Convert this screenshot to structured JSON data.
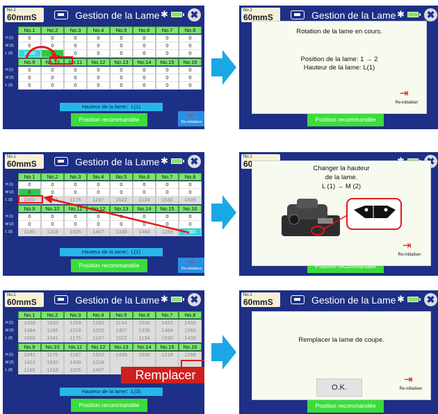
{
  "header": {
    "mode_number": "No.1",
    "mode_value": "60mmS",
    "title": "Gestion de la Lame",
    "bluetooth_glyph": "✱",
    "close_glyph": "✖"
  },
  "columns_top": [
    "No.1",
    "No.2",
    "No.3",
    "No.4",
    "No.5",
    "No.6",
    "No.7",
    "No.8"
  ],
  "columns_bottom": [
    "No.9",
    "No.10",
    "No.11",
    "No.12",
    "No.13",
    "No.14",
    "No.15",
    "No.16"
  ],
  "row_labels": [
    "H (1)",
    "M (2)",
    "L (3)"
  ],
  "buttons": {
    "position": "Position recommandée",
    "reinit": "Re-initialiser",
    "reinit_glyph": "⇥",
    "ok": "O.K."
  },
  "panels": [
    {
      "height_bar": "Hauteur de la lame：L(1)",
      "top_rows": [
        [
          "0",
          "0",
          "0",
          "0",
          "0",
          "0",
          "0",
          "0"
        ],
        [
          "0",
          "0",
          "0",
          "0",
          "0",
          "0",
          "0",
          "0"
        ],
        [
          "1060",
          "0",
          "0",
          "0",
          "0",
          "0",
          "0",
          "0"
        ]
      ],
      "bottom_rows": [
        [
          "0",
          "0",
          "0",
          "0",
          "0",
          "0",
          "0",
          "0"
        ],
        [
          "0",
          "0",
          "0",
          "0",
          "0",
          "0",
          "0",
          "0"
        ],
        [
          "0",
          "0",
          "0",
          "0",
          "0",
          "0",
          "0",
          "0"
        ]
      ]
    },
    {
      "dialog_lines": [
        "Rotation de la lame en cours.",
        "",
        "Position de la lame:  1 → 2",
        "Hauteur de la lame: L(1)"
      ]
    },
    {
      "height_bar": "Hauteur de la lame：L(1)",
      "top_rows": [
        [
          "0",
          "0",
          "0",
          "0",
          "0",
          "0",
          "0",
          "0"
        ],
        [
          "0",
          "0",
          "0",
          "0",
          "0",
          "0",
          "0",
          "0"
        ],
        [
          "1060",
          "1041",
          "1175",
          "1167",
          "1522",
          "1134",
          "1530",
          "1439"
        ]
      ],
      "bottom_rows": [
        [
          "0",
          "0",
          "0",
          "0",
          "0",
          "0",
          "0",
          "0"
        ],
        [
          "0",
          "0",
          "0",
          "0",
          "0",
          "0",
          "0",
          "0"
        ],
        [
          "1185",
          "1218",
          "1025",
          "1407",
          "1338",
          "1484",
          "1259",
          "1060"
        ]
      ]
    },
    {
      "dialog_lines": [
        "Changer la hauteur",
        "de la lame.",
        "L (1)  →  M (2)"
      ]
    },
    {
      "height_bar": "Hauteur de la lame：L(3)",
      "replace_label": "Remplacer",
      "top_rows": [
        [
          "1439",
          "1530",
          "1259",
          "1185",
          "1134",
          "1530",
          "1422",
          "1439"
        ],
        [
          "1484",
          "1185",
          "1218",
          "1025",
          "1407",
          "1338",
          "1484",
          "1060"
        ],
        [
          "1060",
          "1041",
          "1175",
          "1167",
          "1522",
          "1134",
          "1530",
          "1439"
        ]
      ],
      "bottom_rows": [
        [
          "1041",
          "1175",
          "1167",
          "1522",
          "1439",
          "1530",
          "1218",
          "1258"
        ],
        [
          "1422",
          "1530",
          "1439",
          "1218",
          "",
          "",
          "",
          ""
        ],
        [
          "1185",
          "1218",
          "1025",
          "1407",
          "",
          "",
          "",
          ""
        ]
      ]
    },
    {
      "dialog_lines": [
        "Remplacer la lame de coupe."
      ]
    }
  ],
  "colors": {
    "screen_bg": "#1e2f86",
    "header_cell": "#7de36e",
    "accent_cyan": "#32d6e2",
    "highlight_red": "#e21818",
    "arrow_blue": "#1aa7e6"
  }
}
